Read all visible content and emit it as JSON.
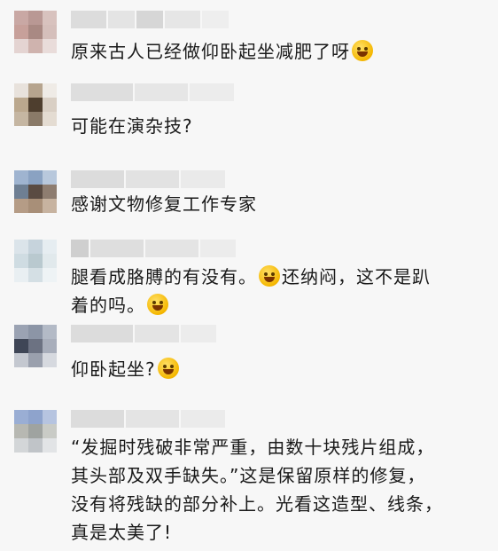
{
  "comments": [
    {
      "text": "原来古人已经做仰卧起坐减肥了呀",
      "emoji": "thinking-face-emoji"
    },
    {
      "text": "可能在演杂技?",
      "emoji": ""
    },
    {
      "text": "感谢文物修复工作专家",
      "emoji": ""
    },
    {
      "text_line1_a": "腿看成胳膊的有没有。",
      "emoji_a": "tears-of-joy-emoji",
      "text_line1_b": "还纳闷，这不是趴",
      "text_line2": "着的吗。",
      "emoji_b": "tears-of-joy-emoji"
    },
    {
      "text": "仰卧起坐?",
      "emoji": "grinning-face-emoji"
    },
    {
      "text": "“发掘时残破非常严重，由数十块残片组成，\n其头部及双手缺失。”这是保留原样的修复，\n没有将残缺的部分补上。光看这造型、线条，\n真是太美了!"
    }
  ],
  "colors": {
    "background": "#f7f7f7",
    "text": "#1a1a1a",
    "emoji": "#f5b700"
  }
}
